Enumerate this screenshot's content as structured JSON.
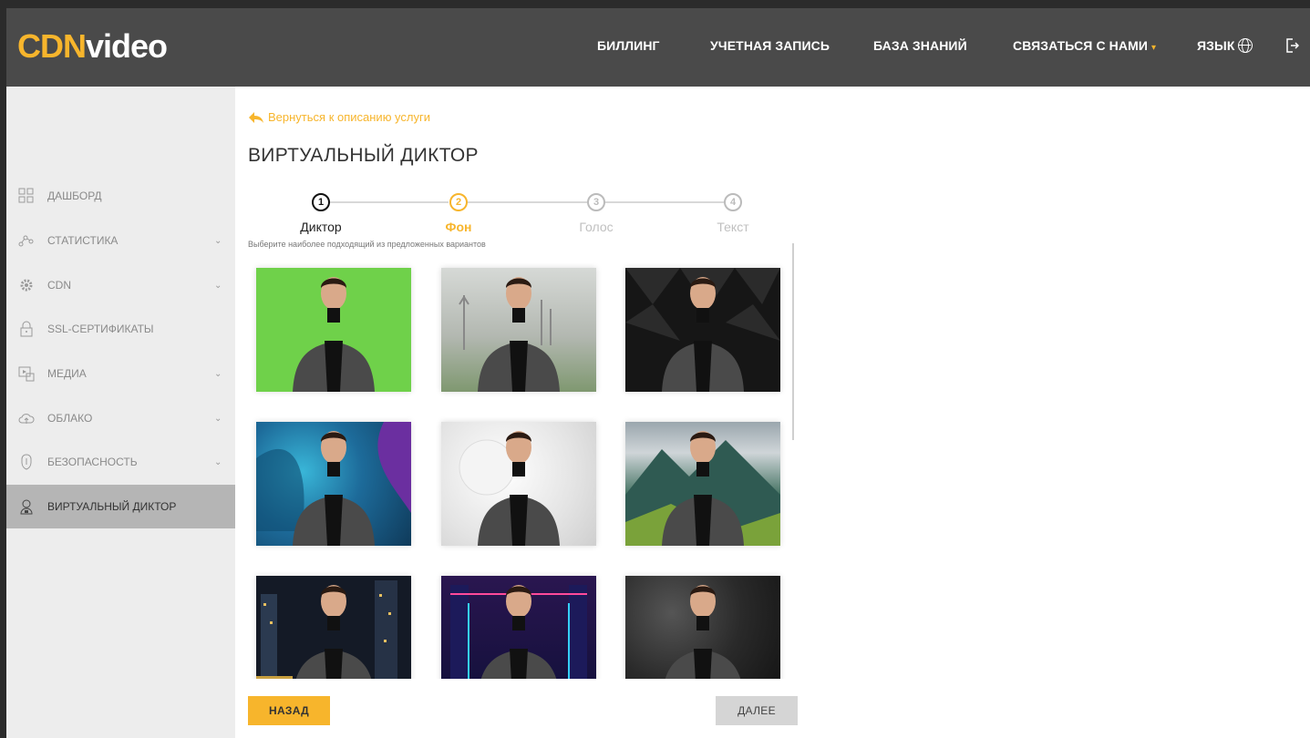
{
  "header": {
    "logo_cdn": "CDN",
    "logo_video": "video",
    "nav": [
      "БИЛЛИНГ",
      "УЧЕТНАЯ ЗАПИСЬ",
      "БАЗА ЗНАНИЙ",
      "СВЯЗАТЬСЯ С НАМИ",
      "ЯЗЫК"
    ],
    "accent": "#f7b52c"
  },
  "sidebar": {
    "items": [
      {
        "label": "ДАШБОРД",
        "icon": "dashboard-icon"
      },
      {
        "label": "СТАТИСТИКА",
        "icon": "stats-icon"
      },
      {
        "label": "CDN",
        "icon": "gear-icon"
      },
      {
        "label": "SSL-СЕРТИФИКАТЫ",
        "icon": "lock-icon"
      },
      {
        "label": "МЕДИА",
        "icon": "media-icon"
      },
      {
        "label": "ОБЛАКО",
        "icon": "cloud-icon"
      },
      {
        "label": "БЕЗОПАСНОСТЬ",
        "icon": "security-icon"
      },
      {
        "label": "ВИРТУАЛЬНЫЙ ДИКТОР",
        "icon": "presenter-icon"
      }
    ],
    "active_index": 7
  },
  "main": {
    "back_link": "Вернуться к описанию услуги",
    "title": "ВИРТУАЛЬНЫЙ ДИКТОР",
    "steps": [
      {
        "num": "1",
        "label": "Диктор",
        "state": "done"
      },
      {
        "num": "2",
        "label": "Фон",
        "state": "current"
      },
      {
        "num": "3",
        "label": "Голос",
        "state": "todo"
      },
      {
        "num": "4",
        "label": "Текст",
        "state": "todo"
      }
    ],
    "hint": "Выберите наиболее подходящий из предложенных вариантов",
    "backgrounds": [
      {
        "name": "green-screen",
        "color": "#6fd14a"
      },
      {
        "name": "foggy-trees",
        "color": "#a9aea6"
      },
      {
        "name": "dark-triangles",
        "color": "#161616"
      },
      {
        "name": "blue-swirl",
        "color": "#1f6c9a"
      },
      {
        "name": "white-studio",
        "color": "#e9e9e9"
      },
      {
        "name": "mountains",
        "color": "#3d6b5a"
      },
      {
        "name": "night-city",
        "color": "#1a1f2c"
      },
      {
        "name": "neon-hall",
        "color": "#1b1440"
      },
      {
        "name": "dark-smoke",
        "color": "#2a2a2a"
      }
    ],
    "back_button": "НАЗАД",
    "next_button": "ДАЛЕЕ"
  }
}
